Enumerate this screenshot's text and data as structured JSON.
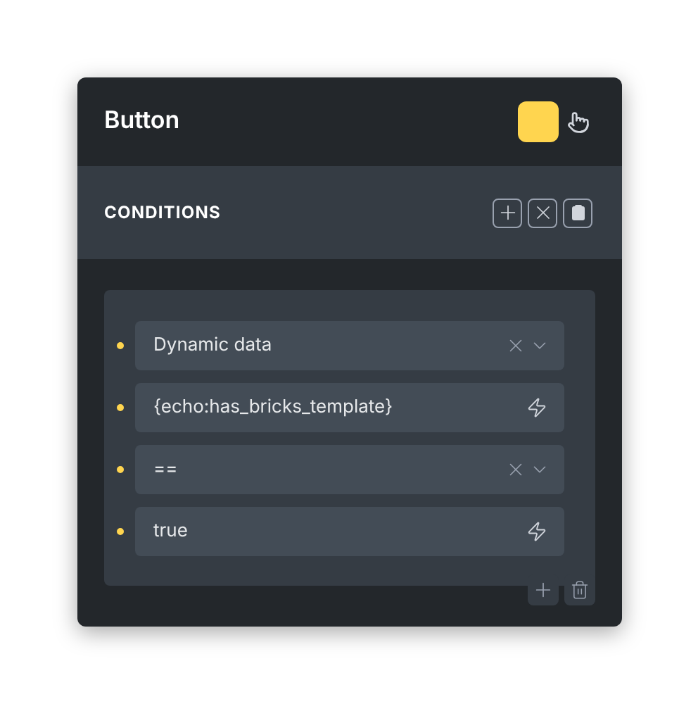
{
  "header": {
    "title": "Button"
  },
  "conditions": {
    "title": "CONDITIONS"
  },
  "fields": [
    {
      "kind": "select",
      "value": "Dynamic data"
    },
    {
      "kind": "dynamic",
      "value": "{echo:has_bricks_template}"
    },
    {
      "kind": "select",
      "value": "=="
    },
    {
      "kind": "dynamic",
      "value": "true"
    }
  ]
}
